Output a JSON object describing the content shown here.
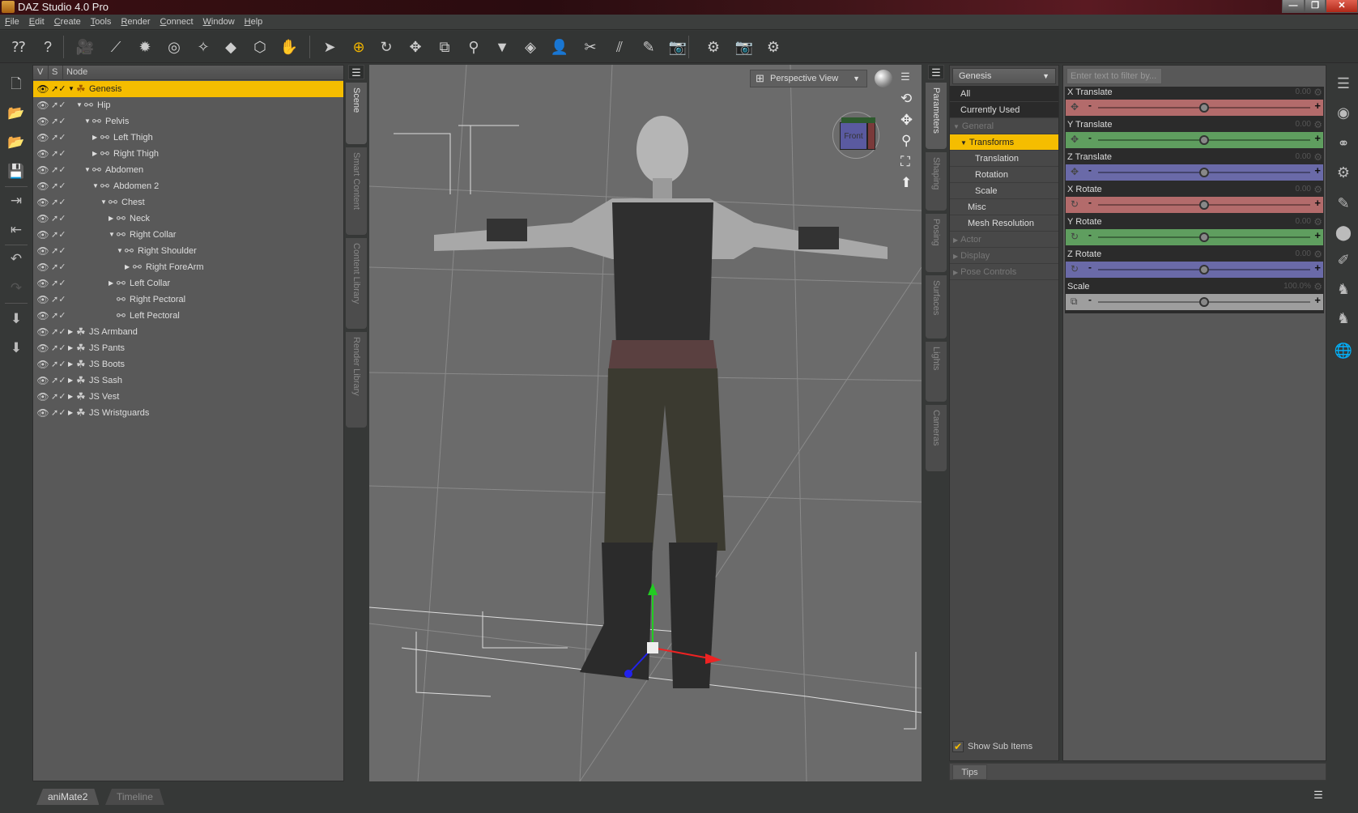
{
  "window": {
    "title": "DAZ Studio 4.0 Pro",
    "minimize": "—",
    "restore": "❐",
    "close": "✕"
  },
  "menu": [
    "File",
    "Edit",
    "Create",
    "Tools",
    "Render",
    "Connect",
    "Window",
    "Help"
  ],
  "toolbar": {
    "buttons": [
      {
        "name": "whats-this",
        "glyph": "⁇"
      },
      {
        "name": "help",
        "glyph": "?"
      },
      {
        "name": "create-camera",
        "glyph": "🎥"
      },
      {
        "name": "create-distant-light",
        "glyph": "⟋"
      },
      {
        "name": "create-point-light",
        "glyph": "✹"
      },
      {
        "name": "create-spotlight-dial",
        "glyph": "◎"
      },
      {
        "name": "create-spotlight",
        "glyph": "✧"
      },
      {
        "name": "create-primitive",
        "glyph": "◆"
      },
      {
        "name": "create-null",
        "glyph": "⬡"
      },
      {
        "name": "create-new-figure",
        "glyph": "✋"
      },
      {
        "name": "node-selection-tool",
        "glyph": "➤"
      },
      {
        "name": "universal-tool",
        "glyph": "⊕"
      },
      {
        "name": "rotate-tool",
        "glyph": "↻"
      },
      {
        "name": "translate-tool",
        "glyph": "✥"
      },
      {
        "name": "scale-tool",
        "glyph": "⧉"
      },
      {
        "name": "joint-editor-tool",
        "glyph": "⚲"
      },
      {
        "name": "geometry-tool",
        "glyph": "▼"
      },
      {
        "name": "surface-selection-tool",
        "glyph": "◈"
      },
      {
        "name": "region-navigator-tool",
        "glyph": "👤"
      },
      {
        "name": "weight-map-tool",
        "glyph": "✂"
      },
      {
        "name": "hair-brush-tool",
        "glyph": "⫽"
      },
      {
        "name": "surface-paint-tool",
        "glyph": "✎"
      },
      {
        "name": "spot-render-tool",
        "glyph": "📷"
      },
      {
        "name": "render-settings",
        "glyph": "⚙"
      },
      {
        "name": "render",
        "glyph": "📷"
      },
      {
        "name": "advanced-render-settings",
        "glyph": "⚙"
      }
    ],
    "active_tool": "universal-tool"
  },
  "left_icons": [
    "new-scene",
    "open-file",
    "merge-file",
    "save",
    "import",
    "export",
    "undo",
    "redo",
    "send-to-hexagon",
    "bridge-export"
  ],
  "scene": {
    "headers": {
      "v": "V",
      "s": "S",
      "node": "Node"
    },
    "nodes": [
      {
        "label": "Genesis",
        "depth": 0,
        "expand": "open",
        "type": "figure",
        "selected": true
      },
      {
        "label": "Hip",
        "depth": 1,
        "expand": "open",
        "type": "bone"
      },
      {
        "label": "Pelvis",
        "depth": 2,
        "expand": "open",
        "type": "bone"
      },
      {
        "label": "Left Thigh",
        "depth": 3,
        "expand": "closed",
        "type": "bone"
      },
      {
        "label": "Right Thigh",
        "depth": 3,
        "expand": "closed",
        "type": "bone"
      },
      {
        "label": "Abdomen",
        "depth": 2,
        "expand": "open",
        "type": "bone"
      },
      {
        "label": "Abdomen 2",
        "depth": 3,
        "expand": "open",
        "type": "bone"
      },
      {
        "label": "Chest",
        "depth": 4,
        "expand": "open",
        "type": "bone"
      },
      {
        "label": "Neck",
        "depth": 5,
        "expand": "closed",
        "type": "bone"
      },
      {
        "label": "Right Collar",
        "depth": 5,
        "expand": "open",
        "type": "bone"
      },
      {
        "label": "Right Shoulder",
        "depth": 6,
        "expand": "open",
        "type": "bone"
      },
      {
        "label": "Right ForeArm",
        "depth": 7,
        "expand": "closed",
        "type": "bone"
      },
      {
        "label": "Left Collar",
        "depth": 5,
        "expand": "closed",
        "type": "bone"
      },
      {
        "label": "Right Pectoral",
        "depth": 5,
        "expand": "none",
        "type": "bone"
      },
      {
        "label": "Left Pectoral",
        "depth": 5,
        "expand": "none",
        "type": "bone"
      },
      {
        "label": "JS Armband",
        "depth": 0,
        "expand": "closed",
        "type": "figure"
      },
      {
        "label": "JS Pants",
        "depth": 0,
        "expand": "closed",
        "type": "figure"
      },
      {
        "label": "JS Boots",
        "depth": 0,
        "expand": "closed",
        "type": "figure"
      },
      {
        "label": "JS Sash",
        "depth": 0,
        "expand": "closed",
        "type": "figure"
      },
      {
        "label": "JS Vest",
        "depth": 0,
        "expand": "closed",
        "type": "figure"
      },
      {
        "label": "JS Wristguards",
        "depth": 0,
        "expand": "closed",
        "type": "figure"
      }
    ]
  },
  "left_tabs": [
    {
      "label": "Scene",
      "active": true
    },
    {
      "label": "Smart Content",
      "active": false
    },
    {
      "label": "Content Library",
      "active": false
    },
    {
      "label": "Render Library",
      "active": false
    }
  ],
  "viewport": {
    "view": "Perspective View",
    "cube_label": "Front",
    "nav_icons": [
      "orbit",
      "pan",
      "zoom",
      "frame",
      "reset"
    ]
  },
  "right_tabs": [
    {
      "label": "Parameters",
      "active": true
    },
    {
      "label": "Shaping",
      "active": false
    },
    {
      "label": "Posing",
      "active": false
    },
    {
      "label": "Surfaces",
      "active": false
    },
    {
      "label": "Lights",
      "active": false
    },
    {
      "label": "Cameras",
      "active": false
    }
  ],
  "param_tree": {
    "node": "Genesis",
    "items": [
      {
        "label": "All",
        "style": "dark",
        "indent": 1
      },
      {
        "label": "Currently Used",
        "style": "dark",
        "indent": 1
      },
      {
        "label": "General",
        "style": "dim",
        "indent": 0,
        "arrow": "▼"
      },
      {
        "label": "Transforms",
        "style": "sel",
        "indent": 1,
        "arrow": "▼"
      },
      {
        "label": "Translation",
        "style": "",
        "indent": 3
      },
      {
        "label": "Rotation",
        "style": "",
        "indent": 3
      },
      {
        "label": "Scale",
        "style": "",
        "indent": 3
      },
      {
        "label": "Misc",
        "style": "",
        "indent": 2
      },
      {
        "label": "Mesh Resolution",
        "style": "",
        "indent": 2
      },
      {
        "label": "Actor",
        "style": "dim",
        "indent": 0,
        "arrow": "▶"
      },
      {
        "label": "Display",
        "style": "dim",
        "indent": 0,
        "arrow": "▶"
      },
      {
        "label": "Pose Controls",
        "style": "dim",
        "indent": 0,
        "arrow": "▶"
      }
    ],
    "show_sub_items": {
      "label": "Show Sub Items",
      "checked": true
    }
  },
  "params": {
    "filter_placeholder": "Enter text to filter by...",
    "sliders": [
      {
        "name": "X Translate",
        "value": "0.00",
        "position": 0.5,
        "color": "#b36b6b",
        "icon": "✥"
      },
      {
        "name": "Y Translate",
        "value": "0.00",
        "position": 0.5,
        "color": "#5f9e5f",
        "icon": "✥"
      },
      {
        "name": "Z Translate",
        "value": "0.00",
        "position": 0.5,
        "color": "#6a6aa8",
        "icon": "✥"
      },
      {
        "name": "X Rotate",
        "value": "0.00",
        "position": 0.5,
        "color": "#b36b6b",
        "icon": "↻"
      },
      {
        "name": "Y Rotate",
        "value": "0.00",
        "position": 0.5,
        "color": "#5f9e5f",
        "icon": "↻"
      },
      {
        "name": "Z Rotate",
        "value": "0.00",
        "position": 0.5,
        "color": "#6a6aa8",
        "icon": "↻"
      },
      {
        "name": "Scale",
        "value": "100.0%",
        "position": 0.5,
        "color": "#9e9e9e",
        "icon": "⧉"
      }
    ]
  },
  "right_icons": [
    "pane-layout",
    "aux-viewport",
    "shader-mixer",
    "shader-builder",
    "property-editor",
    "joint-editor",
    "property-hierarchy",
    "morph-loader",
    "morph-loader-pro",
    "environment"
  ],
  "tips": {
    "label": "Tips"
  },
  "bottom_tabs": [
    {
      "label": "aniMate2",
      "active": true
    },
    {
      "label": "Timeline",
      "active": false
    }
  ],
  "colors": {
    "accent": "#f5bd00",
    "x_axis": "#b36b6b",
    "y_axis": "#5f9e5f",
    "z_axis": "#6a6aa8"
  }
}
